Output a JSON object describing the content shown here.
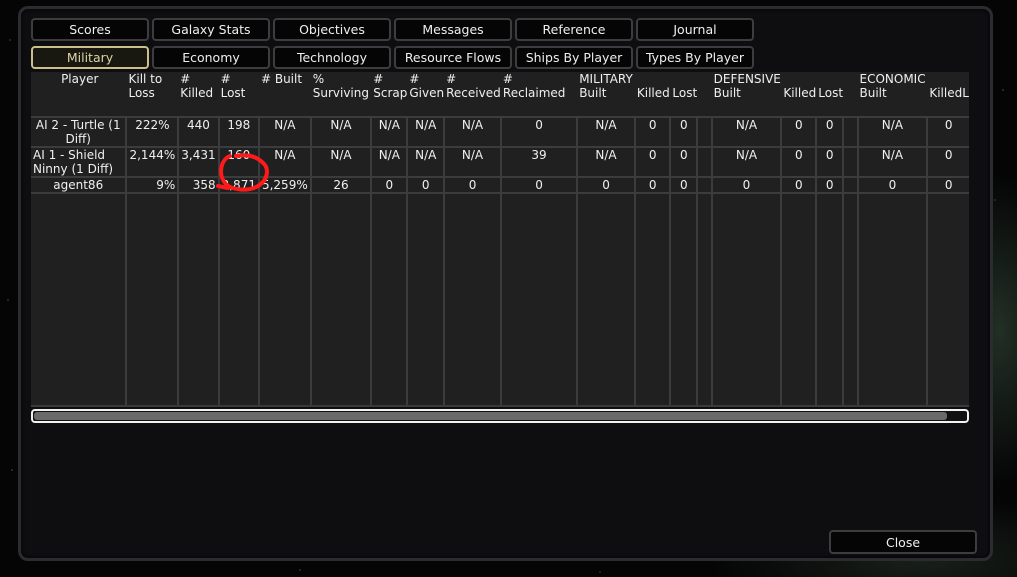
{
  "tabs_row1": [
    {
      "label": "Scores",
      "active": false
    },
    {
      "label": "Galaxy Stats",
      "active": false
    },
    {
      "label": "Objectives",
      "active": false
    },
    {
      "label": "Messages",
      "active": false
    },
    {
      "label": "Reference",
      "active": false
    },
    {
      "label": "Journal",
      "active": false
    }
  ],
  "tabs_row2": [
    {
      "label": "Military",
      "active": true
    },
    {
      "label": "Economy",
      "active": false
    },
    {
      "label": "Technology",
      "active": false
    },
    {
      "label": "Resource Flows",
      "active": false
    },
    {
      "label": "Ships By Player",
      "active": false
    },
    {
      "label": "Types By Player",
      "active": false
    }
  ],
  "table": {
    "headers": {
      "player": "Player",
      "kill_to_loss": "Kill to Loss",
      "killed": "# Killed",
      "lost": "# Lost",
      "built": "# Built",
      "surviving": "% Surviving",
      "scrap": "# Scrap",
      "given": "# Given",
      "received": "# Received",
      "reclaimed": "# Reclaimed",
      "military_group": "MILITARY",
      "military_built": "Built",
      "military_killed": "Killed",
      "military_lost": "Lost",
      "defensive_group": "DEFENSIVE",
      "defensive_built": "Built",
      "defensive_killed": "Killed",
      "defensive_lost": "Lost",
      "economic_group": "ECONOMIC",
      "economic_built": "Built",
      "economic_killed": "Killed",
      "economic_lost_partial": "L"
    },
    "rows": [
      {
        "player": "AI 2 - Turtle (1 Diff)",
        "kill_to_loss": "222%",
        "killed": "440",
        "lost": "198",
        "built": "N/A",
        "surviving": "N/A",
        "scrap": "N/A",
        "given": "N/A",
        "received": "N/A",
        "reclaimed": "0",
        "military_built": "N/A",
        "military_killed": "0",
        "military_lost": "0",
        "defensive_built": "N/A",
        "defensive_killed": "0",
        "defensive_lost": "0",
        "economic_built": "N/A",
        "economic_killed": "0"
      },
      {
        "player": "AI 1 - Shield Ninny (1 Diff)",
        "kill_to_loss": "2,144%",
        "killed": "3,431",
        "lost": "160",
        "built": "N/A",
        "surviving": "N/A",
        "scrap": "N/A",
        "given": "N/A",
        "received": "N/A",
        "reclaimed": "39",
        "military_built": "N/A",
        "military_killed": "0",
        "military_lost": "0",
        "defensive_built": "N/A",
        "defensive_killed": "0",
        "defensive_lost": "0",
        "economic_built": "N/A",
        "economic_killed": "0"
      },
      {
        "player": "agent86",
        "kill_to_loss": "9%",
        "killed": "358",
        "lost": "3,871",
        "built": "5,259%",
        "surviving": "26",
        "scrap": "0",
        "given": "0",
        "received": "0",
        "reclaimed": "0",
        "military_built": "0",
        "military_killed": "0",
        "military_lost": "0",
        "defensive_built": "0",
        "defensive_killed": "0",
        "defensive_lost": "0",
        "economic_built": "0",
        "economic_killed": "0"
      }
    ]
  },
  "scrollbar": {
    "position_fraction": 0.0,
    "visible_fraction": 0.98
  },
  "close_label": "Close",
  "colors": {
    "active_tab_border": "#c9c08b",
    "annotation": "#ff1a1a"
  }
}
